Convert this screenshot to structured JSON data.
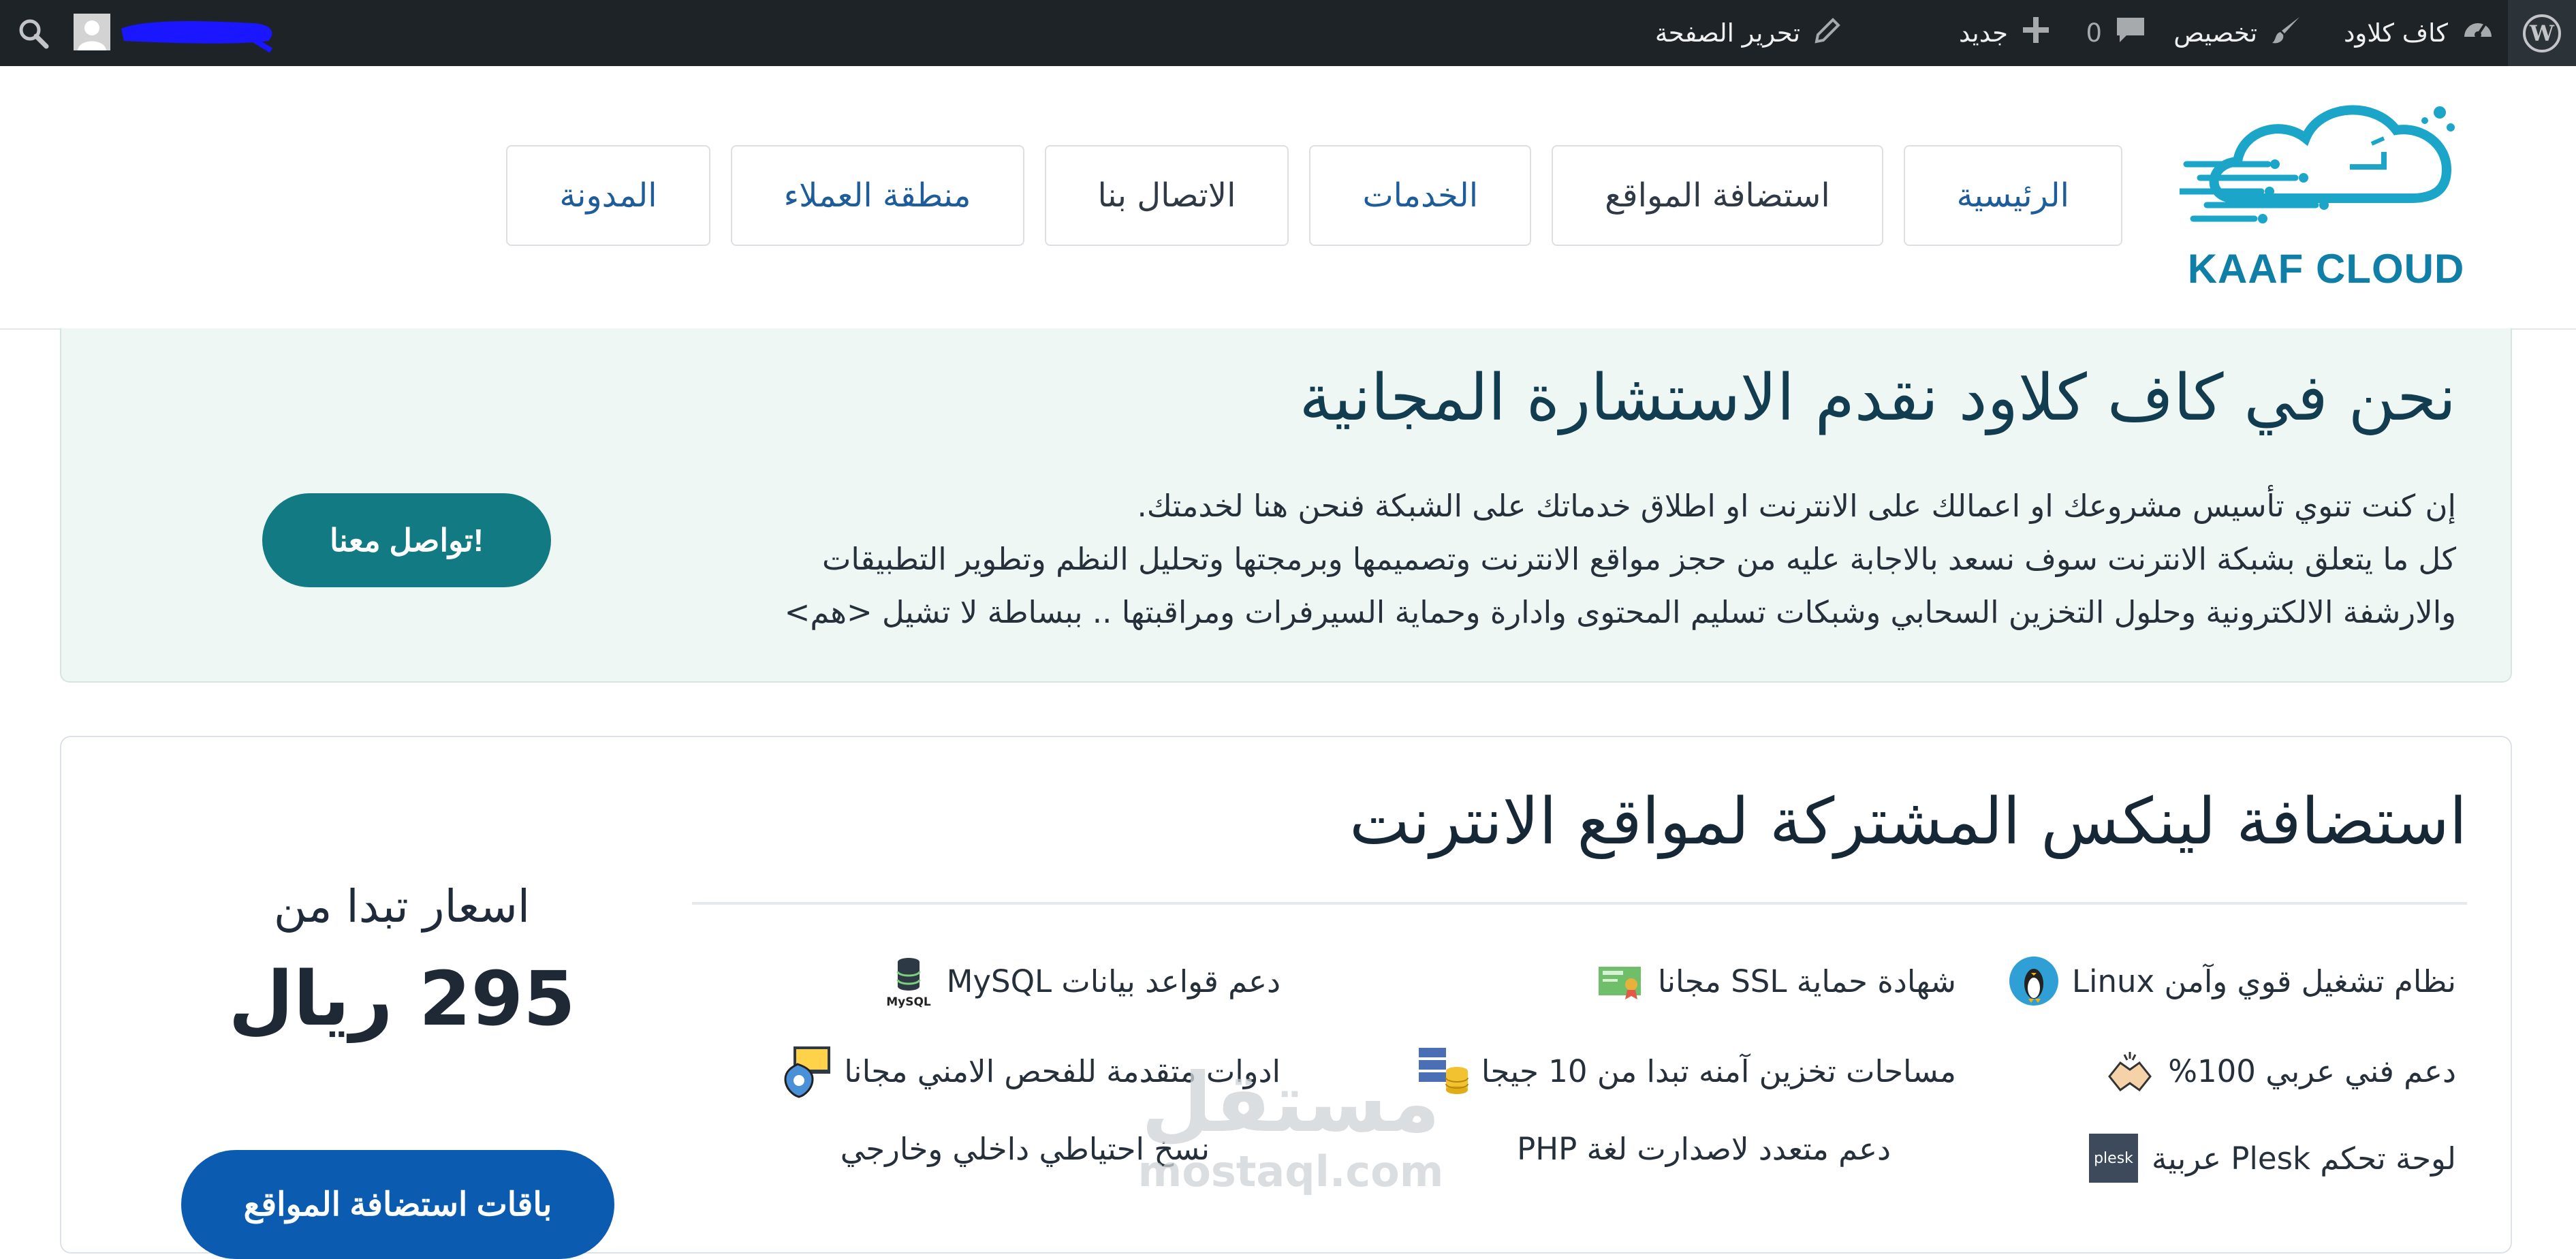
{
  "admin_bar": {
    "site_name": "كاف كلاود",
    "customize": "تخصيص",
    "comments_count": "0",
    "new": "جديد",
    "edit_page": "تحرير الصفحة"
  },
  "logo": {
    "text": "KAAF CLOUD"
  },
  "nav": {
    "items": [
      {
        "label": "الرئيسية"
      },
      {
        "label": "استضافة المواقع"
      },
      {
        "label": "الخدمات"
      },
      {
        "label": "الاتصال بنا"
      },
      {
        "label": "منطقة العملاء"
      },
      {
        "label": "المدونة"
      }
    ]
  },
  "consult": {
    "title": "نحن في كاف كلاود نقدم الاستشارة المجانية",
    "lines": [
      "إن كنت تنوي تأسيس مشروعك او اعمالك على الانترنت او اطلاق خدماتك على الشبكة فنحن هنا لخدمتك.",
      "كل ما يتعلق بشبكة الانترنت سوف نسعد بالاجابة عليه من حجز مواقع الانترنت وتصميمها وبرمجتها وتحليل النظم وتطوير التطبيقات",
      "والارشفة الالكترونية وحلول التخزين السحابي وشبكات تسليم المحتوى وادارة وحماية السيرفرات ومراقبتها .. ببساطة لا تشيل <هم>"
    ],
    "button": "تواصل معنا!"
  },
  "hosting": {
    "title": "استضافة لينكس المشتركة لمواقع الانترنت",
    "features": [
      {
        "icon": "linux-penguin-icon",
        "text": "نظام تشغيل قوي وآمن Linux"
      },
      {
        "icon": "ssl-certificate-icon",
        "text": "شهادة حماية SSL مجانا"
      },
      {
        "icon": "mysql-database-icon",
        "text": "دعم قواعد بيانات MySQL"
      },
      {
        "icon": "handshake-icon",
        "text": "دعم فني عربي 100%"
      },
      {
        "icon": "storage-servers-icon",
        "text": "مساحات تخزين آمنه تبدا من 10 جيجا"
      },
      {
        "icon": "security-scan-icon",
        "text": "ادوات متقدمة للفحص الامني مجانا"
      },
      {
        "icon": "plesk-icon",
        "text": "لوحة تحكم Plesk عربية",
        "icon_label": "plesk"
      },
      {
        "icon": "php-icon",
        "text": "دعم متعدد لاصدارت لغة PHP"
      },
      {
        "icon": "backup-icon",
        "text": "نسخ احتياطي داخلي وخارجي"
      }
    ],
    "price_label": "اسعار تبدا من",
    "price_value": "295 ريال",
    "plans_button": "باقات استضافة المواقع"
  },
  "watermark": {
    "arabic": "مستقل",
    "latin": "mostaql.com"
  },
  "colors": {
    "admin_bar": "#1d2327",
    "brand_blue": "#0f7fa8",
    "nav_link": "#1f5d9a",
    "consult_bg": "#eef7f4",
    "teal_button": "#117a83",
    "blue_button": "#0b5cb0"
  }
}
